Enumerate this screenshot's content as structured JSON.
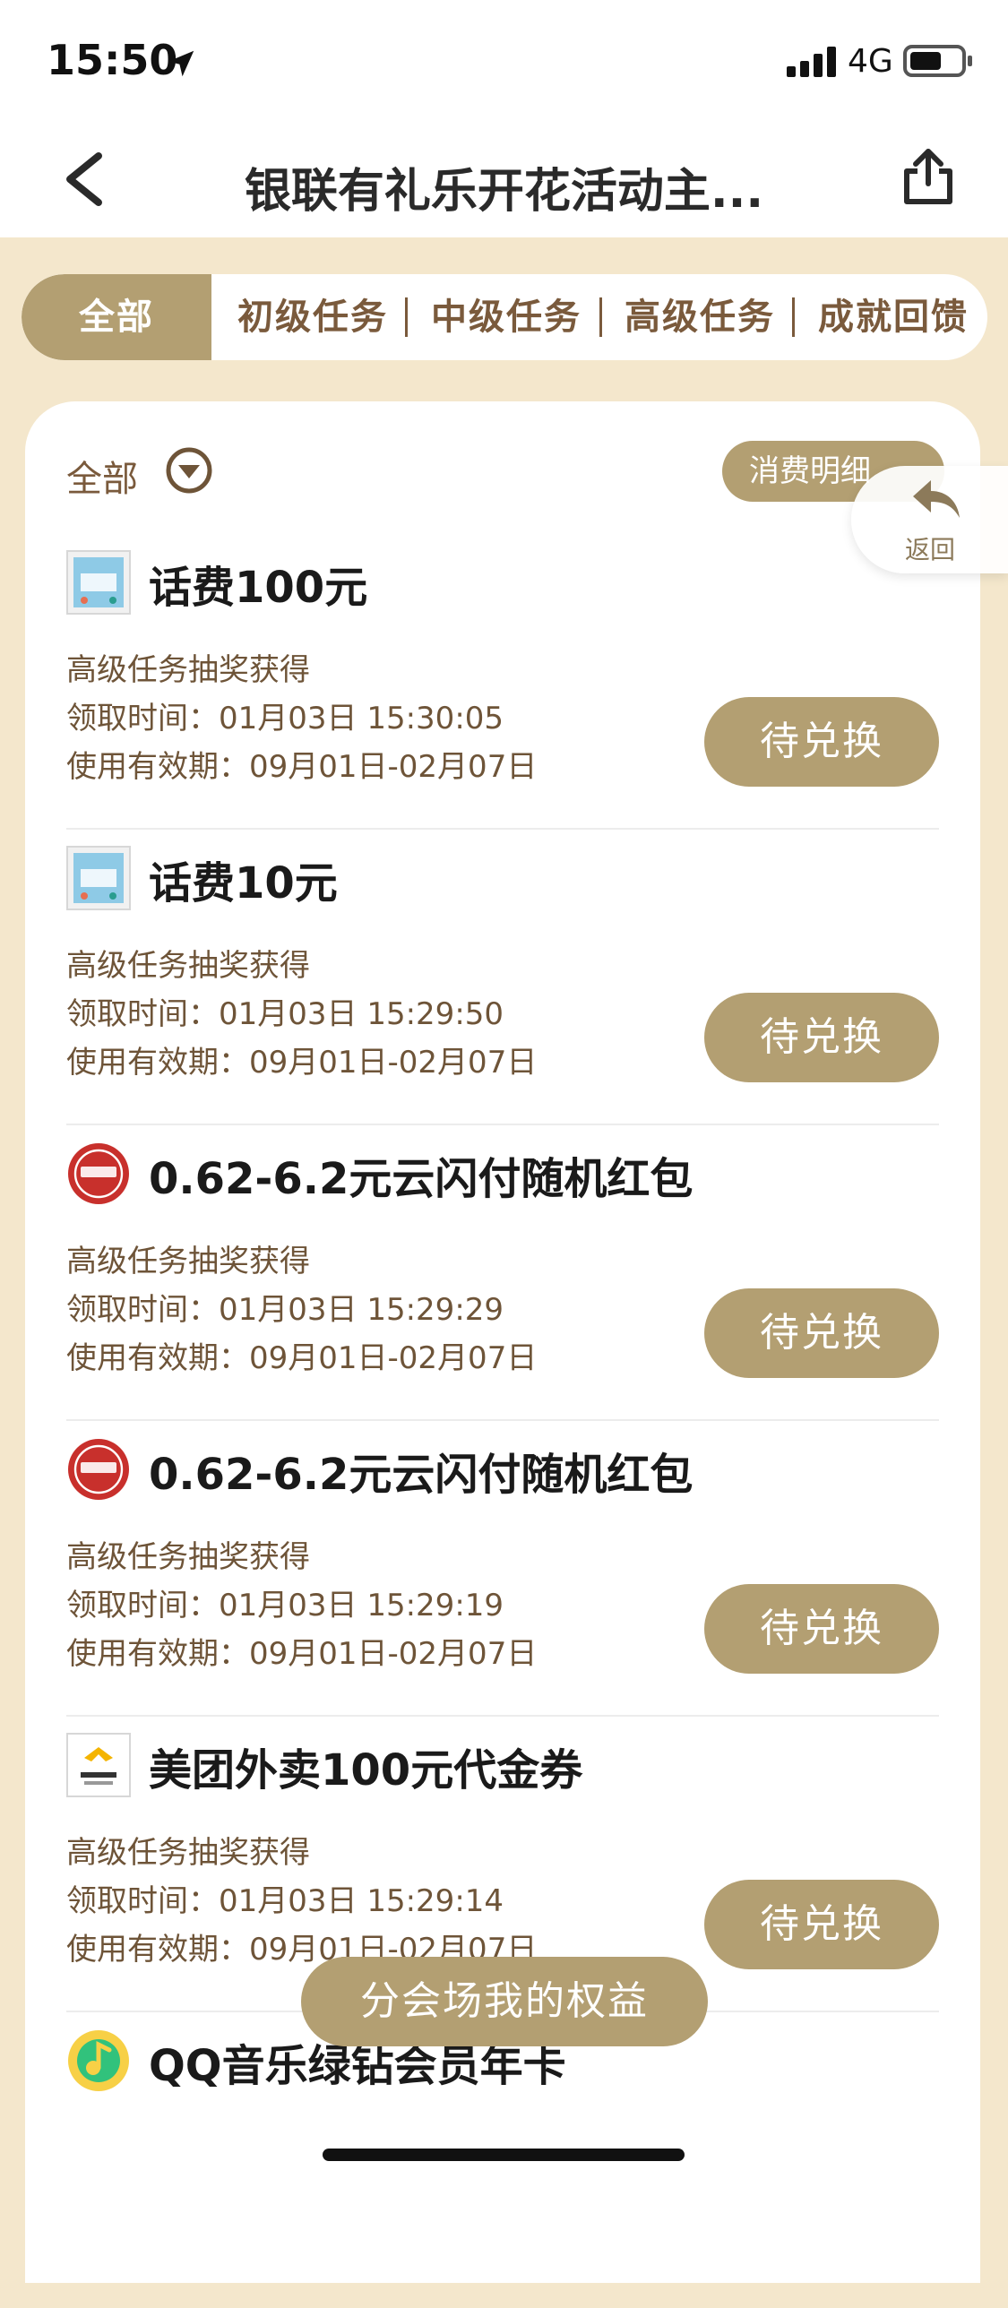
{
  "status_bar": {
    "time": "15:50",
    "network": "4G"
  },
  "nav": {
    "title": "银联有礼乐开花活动主..."
  },
  "tabs": [
    {
      "label": "全部"
    },
    {
      "label": "初级任务"
    },
    {
      "label": "中级任务"
    },
    {
      "label": "高级任务"
    },
    {
      "label": "成就回馈"
    }
  ],
  "filter": {
    "label": "全部",
    "detail_label": "消费明细"
  },
  "float_back": {
    "label": "返回"
  },
  "items": [
    {
      "title": "话费100元",
      "source": "高级任务抽奖获得",
      "received": "领取时间：01月03日 15:30:05",
      "validity": "使用有效期：09月01日-02月07日",
      "button": "待兑换"
    },
    {
      "title": "话费10元",
      "source": "高级任务抽奖获得",
      "received": "领取时间：01月03日 15:29:50",
      "validity": "使用有效期：09月01日-02月07日",
      "button": "待兑换"
    },
    {
      "title": "0.62-6.2元云闪付随机红包",
      "source": "高级任务抽奖获得",
      "received": "领取时间：01月03日 15:29:29",
      "validity": "使用有效期：09月01日-02月07日",
      "button": "待兑换"
    },
    {
      "title": "0.62-6.2元云闪付随机红包",
      "source": "高级任务抽奖获得",
      "received": "领取时间：01月03日 15:29:19",
      "validity": "使用有效期：09月01日-02月07日",
      "button": "待兑换"
    },
    {
      "title": "美团外卖100元代金券",
      "source": "高级任务抽奖获得",
      "received": "领取时间：01月03日 15:29:14",
      "validity": "使用有效期：09月01日-02月07日",
      "button": "待兑换"
    },
    {
      "title": "QQ音乐绿钻会员年卡"
    }
  ],
  "bottom_button": {
    "label": "分会场我的权益"
  },
  "colors": {
    "accent": "#b39f72",
    "page_bg": "#f4e7cc",
    "text_brown": "#6e5438"
  }
}
